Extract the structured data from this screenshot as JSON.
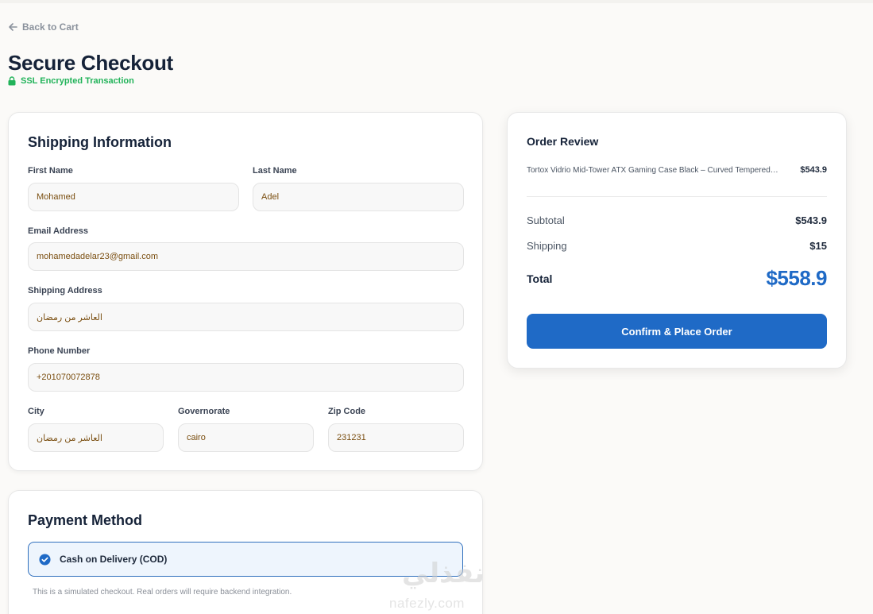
{
  "nav": {
    "back_label": "Back to Cart"
  },
  "page": {
    "title": "Secure Checkout",
    "ssl_label": "SSL Encrypted Transaction"
  },
  "shipping": {
    "heading": "Shipping Information",
    "first_name": {
      "label": "First Name",
      "value": "Mohamed"
    },
    "last_name": {
      "label": "Last Name",
      "value": "Adel"
    },
    "email": {
      "label": "Email Address",
      "value": "mohamedadelar23@gmail.com"
    },
    "address": {
      "label": "Shipping Address",
      "value": "العاشر من رمضان"
    },
    "phone": {
      "label": "Phone Number",
      "value": "+201070072878"
    },
    "city": {
      "label": "City",
      "value": "العاشر من رمضان"
    },
    "governorate": {
      "label": "Governorate",
      "value": "cairo"
    },
    "zip": {
      "label": "Zip Code",
      "value": "231231"
    }
  },
  "payment": {
    "heading": "Payment Method",
    "option_label": "Cash on Delivery (COD)",
    "note": "This is a simulated checkout. Real orders will require backend integration."
  },
  "order": {
    "heading": "Order Review",
    "items": [
      {
        "name": "Tortox Vidrio Mid-Tower ATX Gaming Case Black – Curved Tempered…",
        "price": "$543.9"
      }
    ],
    "subtotal_label": "Subtotal",
    "subtotal": "$543.9",
    "shipping_label": "Shipping",
    "shipping": "$15",
    "total_label": "Total",
    "total": "$558.9",
    "confirm_label": "Confirm & Place Order"
  },
  "watermark": {
    "arabic": "نفذلي",
    "latin": "nafezly.com"
  },
  "colors": {
    "accent": "#1f6ac6",
    "success": "#22b35a",
    "input_text": "#7a4e10"
  },
  "icons": [
    "arrow-left-icon",
    "lock-icon",
    "check-circle-icon"
  ]
}
